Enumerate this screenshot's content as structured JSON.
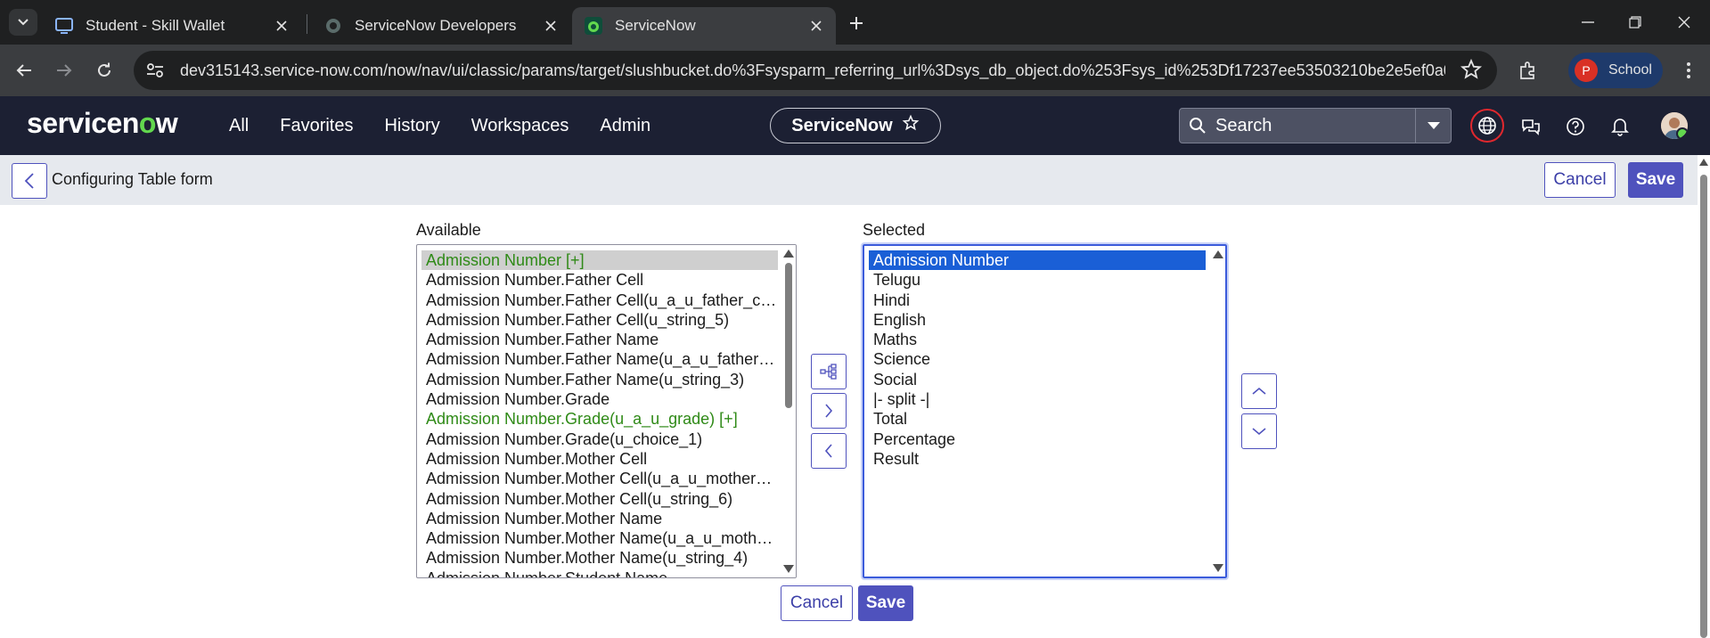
{
  "browser": {
    "tabs": [
      {
        "title": "Student - Skill Wallet",
        "icon": "monitor-icon"
      },
      {
        "title": "ServiceNow Developers",
        "icon": "servicenow-dev-icon"
      },
      {
        "title": "ServiceNow",
        "icon": "servicenow-icon",
        "active": true
      }
    ],
    "url": "dev315143.service-now.com/now/nav/ui/classic/params/target/slushbucket.do%3Fsysparm_referring_url%3Dsys_db_object.do%253Fsys_id%253Df17237ee53503210be2e5ef0a0490e16...",
    "profile_label": "School",
    "profile_initial": "P"
  },
  "sn_header": {
    "logo_pre": "servicen",
    "logo_o": "o",
    "logo_post": "w",
    "nav": [
      "All",
      "Favorites",
      "History",
      "Workspaces",
      "Admin"
    ],
    "app_name": "ServiceNow",
    "search_placeholder": "Search"
  },
  "form": {
    "title": "Configuring Table form",
    "cancel_label": "Cancel",
    "save_label": "Save"
  },
  "slushbucket": {
    "available_label": "Available",
    "selected_label": "Selected",
    "available": [
      {
        "text": "Admission Number [+]",
        "style": "green sel-grey"
      },
      {
        "text": "Admission Number.Father Cell",
        "style": ""
      },
      {
        "text": "Admission Number.Father Cell(u_a_u_father_cell)",
        "style": ""
      },
      {
        "text": "Admission Number.Father Cell(u_string_5)",
        "style": ""
      },
      {
        "text": "Admission Number.Father Name",
        "style": ""
      },
      {
        "text": "Admission Number.Father Name(u_a_u_father_na…",
        "style": ""
      },
      {
        "text": "Admission Number.Father Name(u_string_3)",
        "style": ""
      },
      {
        "text": "Admission Number.Grade",
        "style": ""
      },
      {
        "text": "Admission Number.Grade(u_a_u_grade) [+]",
        "style": "green"
      },
      {
        "text": "Admission Number.Grade(u_choice_1)",
        "style": ""
      },
      {
        "text": "Admission Number.Mother Cell",
        "style": ""
      },
      {
        "text": "Admission Number.Mother Cell(u_a_u_mother_ce…",
        "style": ""
      },
      {
        "text": "Admission Number.Mother Cell(u_string_6)",
        "style": ""
      },
      {
        "text": "Admission Number.Mother Name",
        "style": ""
      },
      {
        "text": "Admission Number.Mother Name(u_a_u_mother_…",
        "style": ""
      },
      {
        "text": "Admission Number.Mother Name(u_string_4)",
        "style": ""
      },
      {
        "text": "Admission Number.Student Name",
        "style": ""
      }
    ],
    "selected": [
      {
        "text": "Admission Number",
        "style": "sel-blue"
      },
      {
        "text": "Telugu",
        "style": ""
      },
      {
        "text": "Hindi",
        "style": ""
      },
      {
        "text": "English",
        "style": ""
      },
      {
        "text": "Maths",
        "style": ""
      },
      {
        "text": "Science",
        "style": ""
      },
      {
        "text": "Social",
        "style": ""
      },
      {
        "text": "|- split -|",
        "style": ""
      },
      {
        "text": "Total",
        "style": ""
      },
      {
        "text": "Percentage",
        "style": ""
      },
      {
        "text": "Result",
        "style": ""
      }
    ]
  },
  "colors": {
    "brand_accent": "#4f52bd",
    "header_bg": "#1c2033",
    "logo_green": "#62d84e",
    "selected_blue": "#1a5fd6",
    "reference_green": "#2f8a17"
  }
}
